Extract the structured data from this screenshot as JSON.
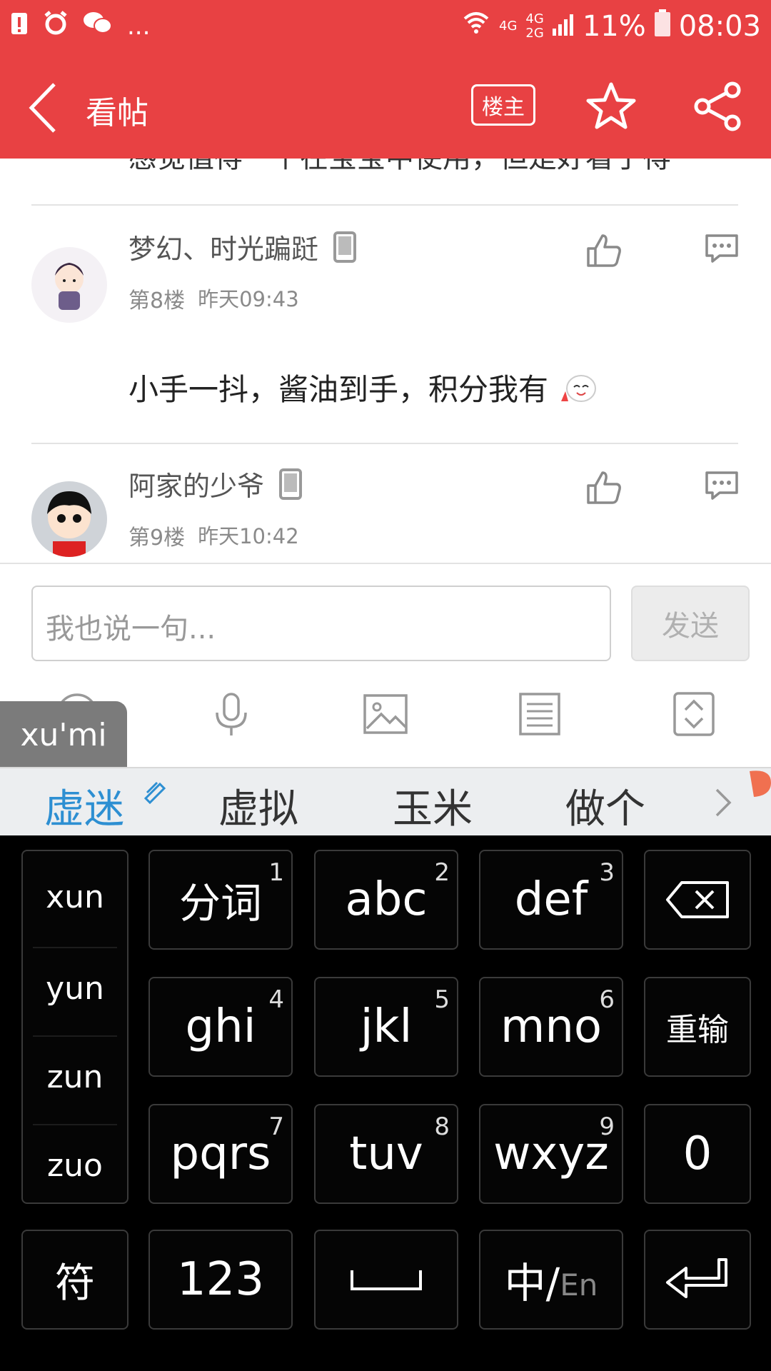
{
  "status_bar": {
    "network_top": "4G",
    "network_bottom_a": "4G",
    "network_bottom_b": "2G",
    "battery": "11%",
    "time": "08:03",
    "dots": "..."
  },
  "app_bar": {
    "title": "看帖",
    "owner_label": "楼主"
  },
  "posts": {
    "cut_text": "感觉值得一个在宝宝中使用，但是好看了得",
    "items": [
      {
        "username": "梦幻、时光蹁跹",
        "floor": "第8楼",
        "time": "昨天09:43",
        "text": "小手一抖，酱油到手，积分我有"
      },
      {
        "username": "阿家的少爷",
        "floor": "第9楼",
        "time": "昨天10:42"
      }
    ]
  },
  "reply": {
    "placeholder": "我也说一句...",
    "send_label": "发送"
  },
  "ime": {
    "pinyin_preview": "xu'mi",
    "candidates": [
      "虚迷",
      "虚拟",
      "玉米",
      "做个"
    ],
    "side_syllables": [
      "xun",
      "yun",
      "zun",
      "zuo"
    ],
    "keys": [
      {
        "label": "分词",
        "num": "1"
      },
      {
        "label": "abc",
        "num": "2"
      },
      {
        "label": "def",
        "num": "3"
      },
      {
        "label": "ghi",
        "num": "4"
      },
      {
        "label": "jkl",
        "num": "5"
      },
      {
        "label": "mno",
        "num": "6"
      },
      {
        "label": "pqrs",
        "num": "7"
      },
      {
        "label": "tuv",
        "num": "8"
      },
      {
        "label": "wxyz",
        "num": "9"
      }
    ],
    "reinput_label": "重输",
    "zero_label": "0",
    "symbol_label": "符",
    "num_label": "123",
    "lang_zh": "中/",
    "lang_en": "En"
  },
  "colors": {
    "brand_red": "#e84143",
    "candidate_active": "#2d8fd2"
  }
}
